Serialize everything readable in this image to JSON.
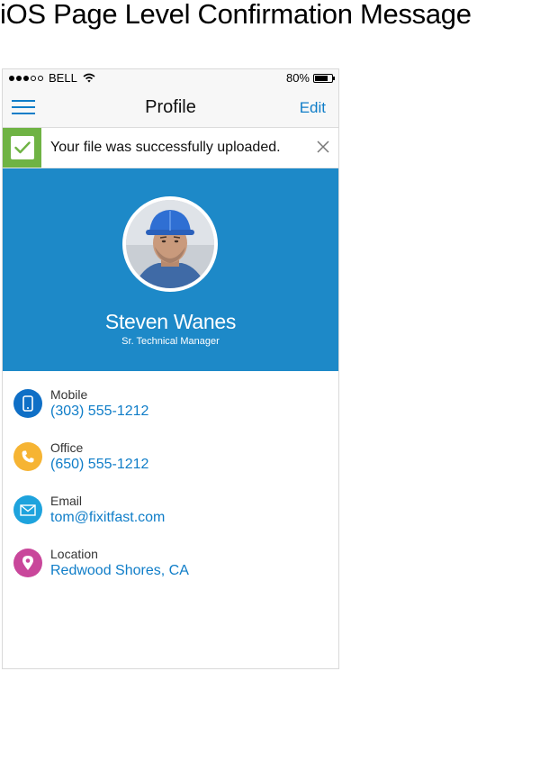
{
  "page_heading": "iOS Page Level Confirmation Message",
  "status_bar": {
    "carrier": "BELL",
    "battery": "80%",
    "battery_level": 0.8
  },
  "navbar": {
    "title": "Profile",
    "edit_label": "Edit"
  },
  "banner": {
    "message": "Your file was successfully uploaded.",
    "accent_color": "#6fb344"
  },
  "profile": {
    "name": "Steven Wanes",
    "job_title": "Sr. Technical Manager",
    "hero_color": "#1d89c8"
  },
  "contacts": [
    {
      "label": "Mobile",
      "value": "(303) 555-1212",
      "icon": "mobile-phone-icon",
      "color": "#0f6fc6"
    },
    {
      "label": "Office",
      "value": "(650) 555-1212",
      "icon": "phone-handset-icon",
      "color": "#f6b433"
    },
    {
      "label": "Email",
      "value": "tom@fixitfast.com",
      "icon": "envelope-icon",
      "color": "#1ea3dd"
    },
    {
      "label": "Location",
      "value": "Redwood Shores, CA",
      "icon": "map-pin-icon",
      "color": "#c9479b"
    }
  ]
}
